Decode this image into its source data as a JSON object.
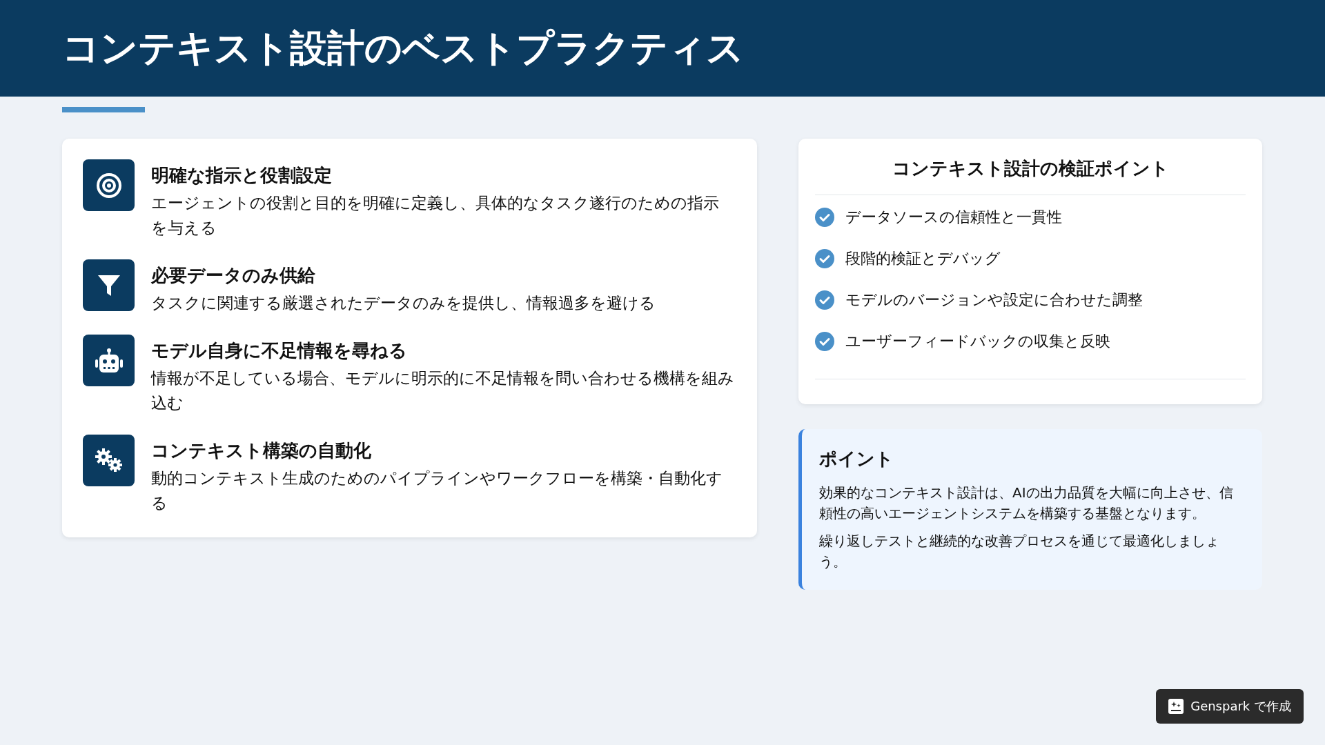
{
  "header": {
    "title": "コンテキスト設計のベストプラクティス"
  },
  "practices": [
    {
      "title": "明確な指示と役割設定",
      "description": "エージェントの役割と目的を明確に定義し、具体的なタスク遂行のための指示を与える"
    },
    {
      "title": "必要データのみ供給",
      "description": "タスクに関連する厳選されたデータのみを提供し、情報過多を避ける"
    },
    {
      "title": "モデル自身に不足情報を尋ねる",
      "description": "情報が不足している場合、モデルに明示的に不足情報を問い合わせる機構を組み込む"
    },
    {
      "title": "コンテキスト構築の自動化",
      "description": "動的コンテキスト生成のためのパイプラインやワークフローを構築・自動化する"
    }
  ],
  "checklist": {
    "title": "コンテキスト設計の検証ポイント",
    "items": [
      "データソースの信頼性と一貫性",
      "段階的検証とデバッグ",
      "モデルのバージョンや設定に合わせた調整",
      "ユーザーフィードバックの収集と反映"
    ]
  },
  "point": {
    "title": "ポイント",
    "paragraphs": [
      "効果的なコンテキスト設計は、AIの出力品質を大幅に向上させ、信頼性の高いエージェントシステムを構築する基盤となります。",
      "繰り返しテストと継続的な改善プロセスを通じて最適化しましょう。"
    ]
  },
  "badge": {
    "label": "Genspark で作成"
  }
}
